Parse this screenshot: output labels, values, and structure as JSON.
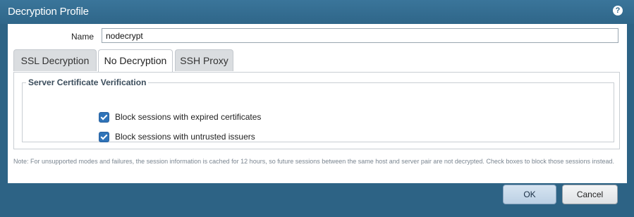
{
  "window": {
    "title": "Decryption Profile",
    "help_icon_glyph": "?"
  },
  "form": {
    "name_label": "Name",
    "name_value": "nodecrypt"
  },
  "tabs": [
    {
      "label": "SSL Decryption",
      "active": false
    },
    {
      "label": "No Decryption",
      "active": true
    },
    {
      "label": "SSH Proxy",
      "active": false
    }
  ],
  "server_cert_verification": {
    "legend": "Server Certificate Verification",
    "options": [
      {
        "label": "Block sessions with expired certificates",
        "checked": true
      },
      {
        "label": "Block sessions with untrusted issuers",
        "checked": true
      }
    ]
  },
  "note": "Note: For unsupported modes and failures, the session information is cached for 12 hours, so future sessions between the same host and server pair are not decrypted. Check boxes to block those sessions instead.",
  "buttons": {
    "ok": "OK",
    "cancel": "Cancel"
  },
  "colors": {
    "frame": "#2d6385",
    "checkbox": "#2f73b8"
  }
}
